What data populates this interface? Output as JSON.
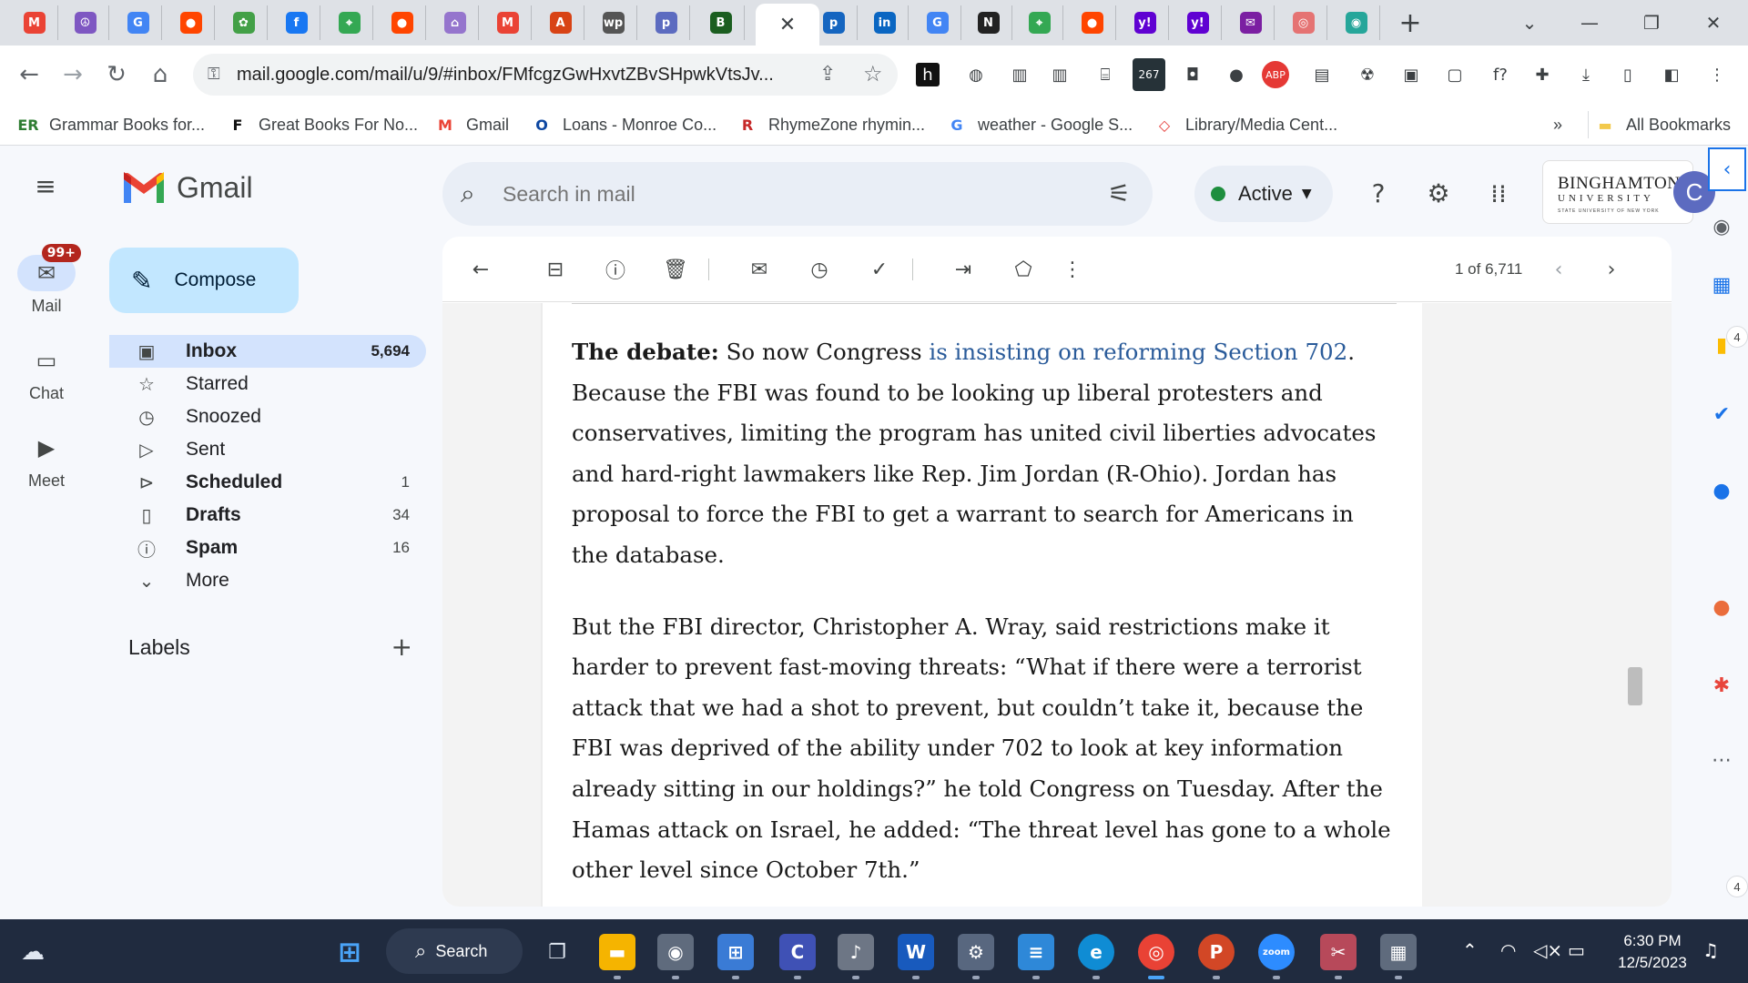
{
  "browser": {
    "tabs": [
      {
        "icon": "gmail-icon",
        "glyph": "M",
        "color": "#ea4335"
      },
      {
        "icon": "peace-icon",
        "glyph": "☮",
        "color": "#7e57c2"
      },
      {
        "icon": "google-icon",
        "glyph": "G",
        "color": "#4285f4"
      },
      {
        "icon": "reddit-icon",
        "glyph": "●",
        "color": "#ff4500"
      },
      {
        "icon": "green-icon",
        "glyph": "✿",
        "color": "#43a047"
      },
      {
        "icon": "facebook-icon",
        "glyph": "f",
        "color": "#1877f2"
      },
      {
        "icon": "maps-icon",
        "glyph": "⌖",
        "color": "#34a853"
      },
      {
        "icon": "reddit-icon",
        "glyph": "●",
        "color": "#ff4500"
      },
      {
        "icon": "home-icon",
        "glyph": "⌂",
        "color": "#9575cd"
      },
      {
        "icon": "gmail-icon",
        "glyph": "M",
        "color": "#ea4335"
      },
      {
        "icon": "pdf-icon",
        "glyph": "A",
        "color": "#d84315"
      },
      {
        "icon": "wp-icon",
        "glyph": "wp",
        "color": "#555555"
      },
      {
        "icon": "p-icon",
        "glyph": "p",
        "color": "#5c6bc0"
      },
      {
        "icon": "b-icon",
        "glyph": "B",
        "color": "#1b5e20"
      },
      {
        "icon": "close-icon",
        "glyph": "✕",
        "color": "#3c4043",
        "active": true
      },
      {
        "icon": "p-icon",
        "glyph": "p",
        "color": "#1565c0"
      },
      {
        "icon": "linkedin-icon",
        "glyph": "in",
        "color": "#0a66c2"
      },
      {
        "icon": "google-icon",
        "glyph": "G",
        "color": "#4285f4"
      },
      {
        "icon": "notion-icon",
        "glyph": "N",
        "color": "#222222"
      },
      {
        "icon": "maps-icon",
        "glyph": "⌖",
        "color": "#34a853"
      },
      {
        "icon": "reddit-icon",
        "glyph": "●",
        "color": "#ff4500"
      },
      {
        "icon": "yahoo-icon",
        "glyph": "y!",
        "color": "#6001d2"
      },
      {
        "icon": "yahoo-icon",
        "glyph": "y!",
        "color": "#6001d2"
      },
      {
        "icon": "mail-icon",
        "glyph": "✉",
        "color": "#7b1fa2"
      },
      {
        "icon": "circle-icon",
        "glyph": "◎",
        "color": "#e57373"
      },
      {
        "icon": "eye-icon",
        "glyph": "◉",
        "color": "#26a69a"
      }
    ],
    "url": "mail.google.com/mail/u/9/#inbox/FMfcgzGwHxvtZBvSHpwkVtsJv...",
    "extensions": [
      {
        "name": "h-ext-icon",
        "glyph": "h"
      },
      {
        "name": "globe-ext-icon",
        "glyph": "◍"
      },
      {
        "name": "building-ext-icon",
        "glyph": "▥"
      },
      {
        "name": "building-ext-icon",
        "glyph": "▥"
      },
      {
        "name": "bank-ext-icon",
        "glyph": "⌸"
      },
      {
        "name": "calendar-ext-icon",
        "glyph": "267"
      },
      {
        "name": "camera-ext-icon",
        "glyph": "◘"
      },
      {
        "name": "cookie-ext-icon",
        "glyph": "●"
      },
      {
        "name": "adblock-ext-icon",
        "glyph": "ABP"
      },
      {
        "name": "tray-ext-icon",
        "glyph": "▤"
      },
      {
        "name": "radiation-ext-icon",
        "glyph": "☢"
      },
      {
        "name": "red-ext-icon",
        "glyph": "▣"
      },
      {
        "name": "save-ext-icon",
        "glyph": "▢"
      },
      {
        "name": "function-ext-icon",
        "glyph": "f?"
      },
      {
        "name": "puzzle-icon",
        "glyph": "✚"
      },
      {
        "name": "download-icon",
        "glyph": "⤓"
      },
      {
        "name": "sidepanel-icon",
        "glyph": "▯"
      },
      {
        "name": "profile-icon",
        "glyph": "◧"
      },
      {
        "name": "menu-icon",
        "glyph": "⋮"
      }
    ],
    "bookmarks": [
      {
        "label": "Grammar Books for...",
        "glyph": "ER",
        "color": "#2e7d32"
      },
      {
        "label": "Great Books For No...",
        "glyph": "F",
        "color": "#111111"
      },
      {
        "label": "Gmail",
        "glyph": "M",
        "color": "#ea4335"
      },
      {
        "label": "Loans - Monroe Co...",
        "glyph": "O",
        "color": "#0d47a1"
      },
      {
        "label": "RhymeZone rhymin...",
        "glyph": "R",
        "color": "#c62828"
      },
      {
        "label": "weather - Google S...",
        "glyph": "G",
        "color": "#4285f4"
      },
      {
        "label": "Library/Media Cent...",
        "glyph": "◇",
        "color": "#e53935"
      }
    ],
    "bookmarks_overflow": "»",
    "all_bookmarks": "All Bookmarks"
  },
  "gmail": {
    "product_name": "Gmail",
    "search_placeholder": "Search in mail",
    "status": "Active",
    "compose_label": "Compose",
    "rail": [
      {
        "label": "Mail",
        "badge": "99+"
      },
      {
        "label": "Chat"
      },
      {
        "label": "Meet"
      }
    ],
    "folders": [
      {
        "label": "Inbox",
        "count": "5,694",
        "icon": "inbox-icon",
        "glyph": "▣"
      },
      {
        "label": "Starred",
        "count": "",
        "icon": "star-icon",
        "glyph": "☆"
      },
      {
        "label": "Snoozed",
        "count": "",
        "icon": "clock-icon",
        "glyph": "◷"
      },
      {
        "label": "Sent",
        "count": "",
        "icon": "send-icon",
        "glyph": "▷"
      },
      {
        "label": "Scheduled",
        "count": "1",
        "icon": "scheduled-icon",
        "glyph": "⊳"
      },
      {
        "label": "Drafts",
        "count": "34",
        "icon": "draft-icon",
        "glyph": "▯"
      },
      {
        "label": "Spam",
        "count": "16",
        "icon": "spam-icon",
        "glyph": "ⓘ"
      },
      {
        "label": "More",
        "count": "",
        "icon": "chevron-down-icon",
        "glyph": "⌄"
      }
    ],
    "labels_heading": "Labels",
    "org_name": "BINGHAMTON",
    "org_sub": "UNIVERSITY",
    "org_tag": "STATE UNIVERSITY OF NEW YORK",
    "avatar_initial": "C",
    "pager": "1 of 6,711"
  },
  "email": {
    "p1_lead": "The debate:",
    "p1_pre": " So now Congress ",
    "p1_link": "is insisting on reforming Section 702",
    "p1_post": ". Because the FBI was found to be looking up liberal protesters and conservatives, limiting the program has united civil liberties advocates and hard-right lawmakers like Rep. Jim Jordan (R-Ohio). Jordan has proposal to force the FBI to get a warrant to search for Americans in the database.",
    "p2": "But the FBI director, Christopher A. Wray, said restrictions make it harder to prevent fast-moving threats: “What if there were a terrorist attack that we had a shot to prevent, but couldn’t take it, because the FBI was deprived of the ability under 702 to look at key information already sitting in our holdings?” he told Congress on Tuesday. After the Hamas attack on Israel, he added: “The threat level has gone to a whole other level since October 7th.”"
  },
  "side_panel": {
    "badge_top": "4",
    "badge_bottom": "4"
  },
  "taskbar": {
    "search_label": "Search",
    "time": "6:30 PM",
    "date": "12/5/2023",
    "apps": [
      {
        "name": "file-explorer-icon",
        "glyph": "▬",
        "color": "#f5b400"
      },
      {
        "name": "camera-icon",
        "glyph": "◉",
        "color": "#5f6b7d"
      },
      {
        "name": "store-icon",
        "glyph": "⊞",
        "color": "#3a7bd5"
      },
      {
        "name": "app-c-icon",
        "glyph": "C",
        "color": "#3f51b5"
      },
      {
        "name": "microphone-icon",
        "glyph": "♪",
        "color": "#6d7685"
      },
      {
        "name": "word-icon",
        "glyph": "W",
        "color": "#185abd"
      },
      {
        "name": "settings-icon",
        "glyph": "⚙",
        "color": "#58677f"
      },
      {
        "name": "notepad-icon",
        "glyph": "≡",
        "color": "#2e88d8"
      },
      {
        "name": "edge-icon",
        "glyph": "e",
        "color": "#0f8cd4"
      },
      {
        "name": "chrome-icon",
        "glyph": "◎",
        "color": "#e94235"
      },
      {
        "name": "powerpoint-icon",
        "glyph": "P",
        "color": "#d24726"
      },
      {
        "name": "zoom-icon",
        "glyph": "zoom",
        "color": "#2d8cff"
      },
      {
        "name": "snipping-icon",
        "glyph": "✂",
        "color": "#b7495a"
      },
      {
        "name": "calculator-icon",
        "glyph": "▦",
        "color": "#5f6b7d"
      }
    ]
  }
}
